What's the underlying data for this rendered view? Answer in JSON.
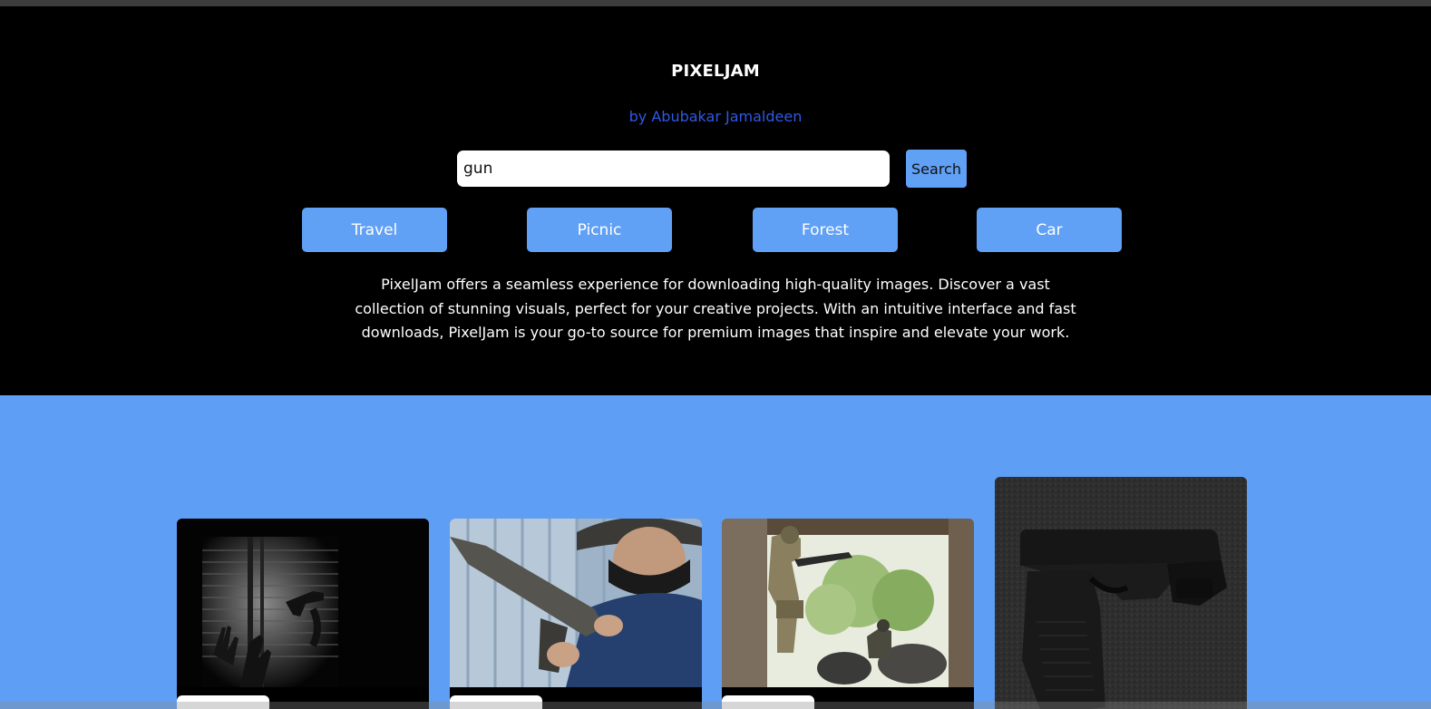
{
  "header": {
    "title": "PIXELJAM",
    "byline": "by Abubakar Jamaldeen"
  },
  "search": {
    "value": "gun",
    "button_label": "Search"
  },
  "categories": [
    "Travel",
    "Picnic",
    "Forest",
    "Car"
  ],
  "description": "PixelJam offers a seamless experience for downloading high-quality images. Discover a vast collection of stunning visuals, perfect for your creative projects. With an intuitive interface and fast downloads, PixelJam is your go-to source for premium images that inspire and elevate your work.",
  "colors": {
    "accent": "#60a0f5",
    "gallery_background": "#5e9ff5",
    "byline": "#2f59e6",
    "header_background": "#000000"
  },
  "gallery": {
    "images": [
      {
        "subject": "shadow of hand holding gun on window blinds"
      },
      {
        "subject": "masked man holding rifle"
      },
      {
        "subject": "soldiers aiming rifles in field"
      },
      {
        "subject": "black pistol on dark textured surface"
      }
    ]
  }
}
